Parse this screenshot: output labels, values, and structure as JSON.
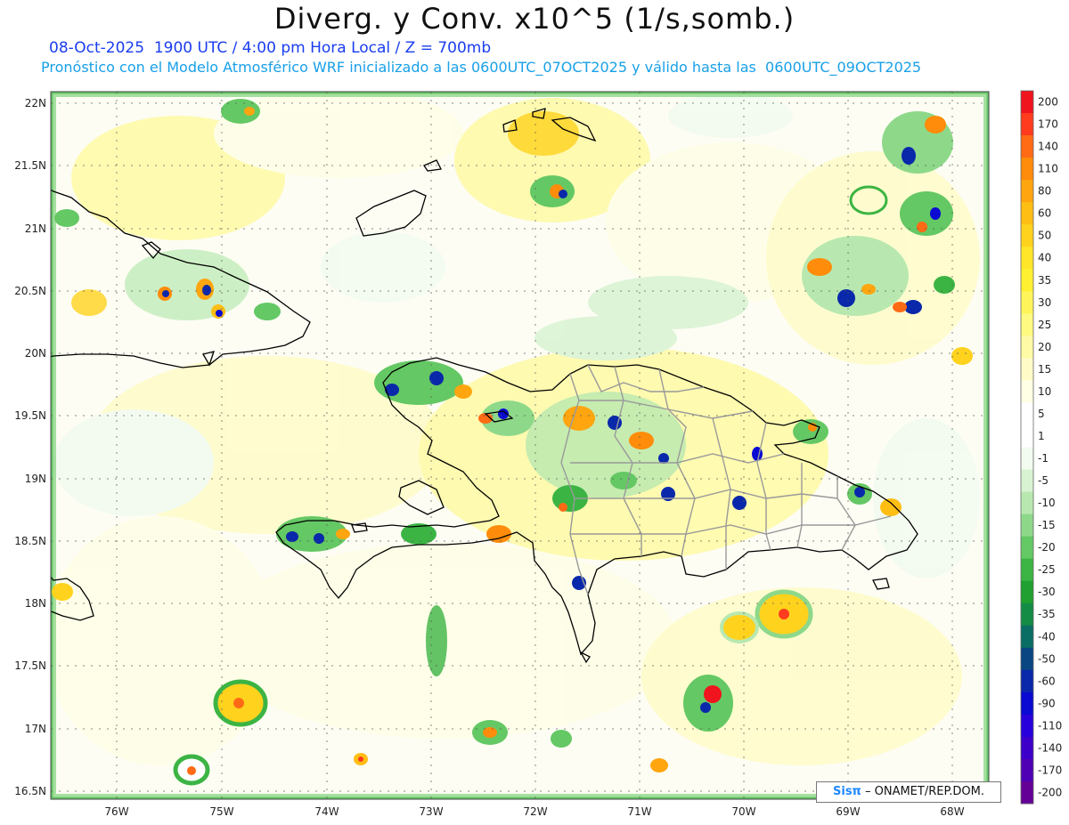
{
  "header": {
    "title": "Diverg. y Conv. x10^5 (1/s,somb.)",
    "subtitle_1": "08-Oct-2025  1900 UTC / 4:00 pm Hora Local / Z = 700mb",
    "subtitle_2": "Pronóstico con el Modelo Atmosférico WRF inicializado a las 0600UTC_07OCT2025 y válido hasta las  0600UTC_09OCT2025"
  },
  "axes": {
    "lat_labels": [
      "22N",
      "21.5N",
      "21N",
      "20.5N",
      "20N",
      "19.5N",
      "19N",
      "18.5N",
      "18N",
      "17.5N",
      "17N",
      "16.5N"
    ],
    "lon_labels": [
      "76W",
      "75W",
      "74W",
      "73W",
      "72W",
      "71W",
      "70W",
      "69W",
      "68W"
    ]
  },
  "colorbar": {
    "labels": [
      "200",
      "170",
      "140",
      "110",
      "80",
      "60",
      "50",
      "40",
      "35",
      "30",
      "25",
      "20",
      "15",
      "10",
      "5",
      "1",
      "-1",
      "-5",
      "-10",
      "-15",
      "-20",
      "-25",
      "-30",
      "-35",
      "-40",
      "-50",
      "-60",
      "-90",
      "-110",
      "-140",
      "-170",
      "-200"
    ],
    "colors": [
      "#f0141e",
      "#ff3c1e",
      "#ff6a14",
      "#ff8c0a",
      "#ffa50f",
      "#ffbe14",
      "#ffd21e",
      "#ffe628",
      "#fff032",
      "#fff55a",
      "#fffa82",
      "#fffaa5",
      "#fffcc8",
      "#ffffe6",
      "#ffffff",
      "#ffffff",
      "#f2fbf0",
      "#d8f3d2",
      "#b8e8b0",
      "#8ed88a",
      "#64c864",
      "#3cb444",
      "#20a030",
      "#138c46",
      "#0a6e64",
      "#0a4682",
      "#0a28aa",
      "#0a0ad2",
      "#2800dc",
      "#3c00c8",
      "#5000b4",
      "#640096"
    ]
  },
  "credit": {
    "brand": "Sisπ",
    "text": " – ONAMET/REP.DOM."
  }
}
